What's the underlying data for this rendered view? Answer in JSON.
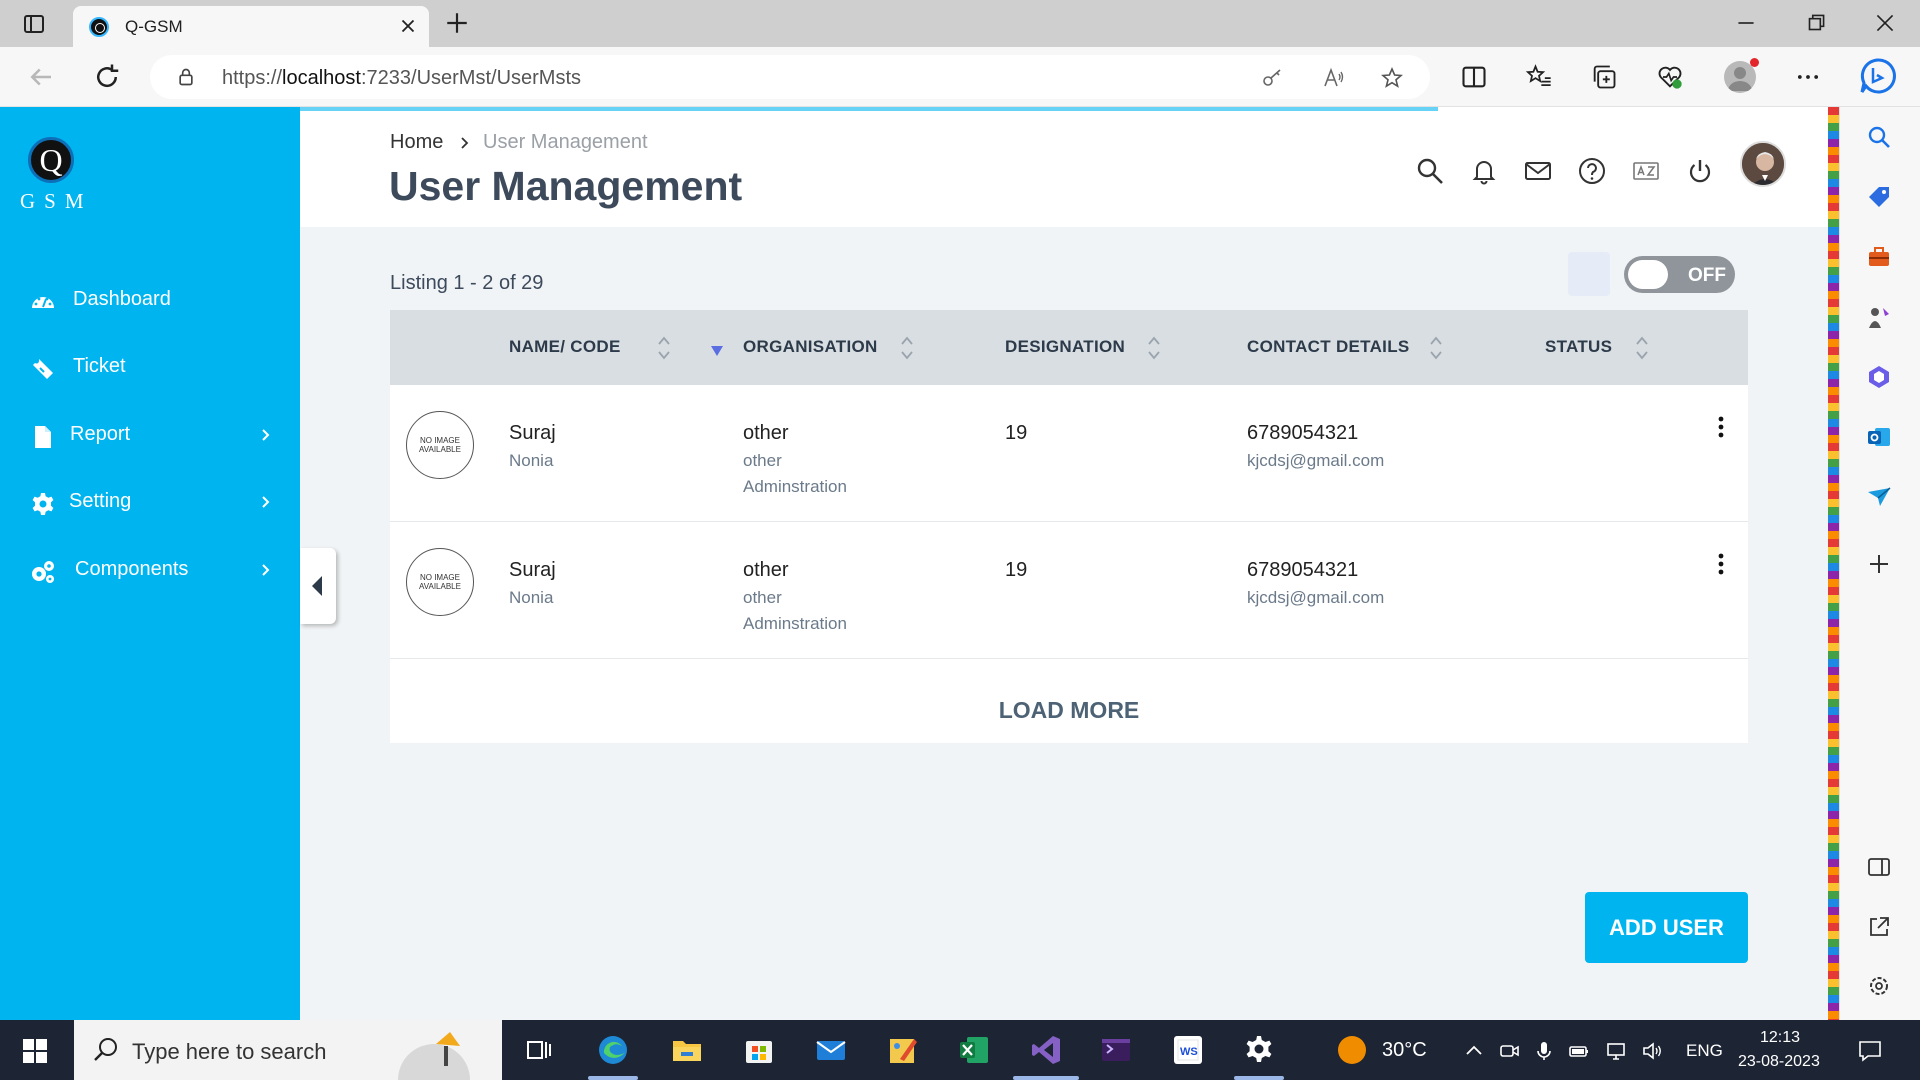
{
  "browser": {
    "tab_title": "Q-GSM",
    "url_prefix": "https://",
    "url_host": "localhost",
    "url_rest": ":7233/UserMst/UserMsts"
  },
  "sidebar": {
    "logo_letter": "Q",
    "logo_text": "GSM",
    "items": [
      {
        "label": "Dashboard",
        "icon": "dashboard-gauge-icon"
      },
      {
        "label": "Ticket",
        "icon": "ticket-icon"
      },
      {
        "label": "Report",
        "icon": "file-icon",
        "has_children": true
      },
      {
        "label": "Setting",
        "icon": "gear-icon",
        "has_children": true
      },
      {
        "label": "Components",
        "icon": "gears-icon",
        "has_children": true
      }
    ]
  },
  "header": {
    "breadcrumb_home": "Home",
    "breadcrumb_current": "User Management",
    "title": "User Management",
    "icons": [
      "search-icon",
      "bell-icon",
      "mail-icon",
      "help-icon",
      "translate-icon",
      "power-icon"
    ]
  },
  "listing": {
    "summary": "Listing 1 - 2 of 29",
    "toggle_label": "OFF"
  },
  "table": {
    "columns": [
      "NAME/ CODE",
      "ORGANISATION",
      "DESIGNATION",
      "CONTACT DETAILS",
      "STATUS"
    ],
    "no_image_text": "NO IMAGE AVAILABLE",
    "rows": [
      {
        "name": "Suraj",
        "code": "Nonia",
        "org": "other",
        "org_sub1": "other",
        "org_sub2": "Adminstration",
        "designation": "19",
        "phone": "6789054321",
        "email": "kjcdsj@gmail.com",
        "status": ""
      },
      {
        "name": "Suraj",
        "code": "Nonia",
        "org": "other",
        "org_sub1": "other",
        "org_sub2": "Adminstration",
        "designation": "19",
        "phone": "6789054321",
        "email": "kjcdsj@gmail.com",
        "status": ""
      }
    ],
    "load_more": "LOAD MORE"
  },
  "add_user_label": "ADD USER",
  "taskbar": {
    "search_placeholder": "Type here to search",
    "temperature": "30°C",
    "language": "ENG",
    "time": "12:13",
    "date": "23-08-2023"
  },
  "colors": {
    "accent": "#00b4f0",
    "title": "#3d4a5c",
    "table_header": "#d9dee2"
  }
}
